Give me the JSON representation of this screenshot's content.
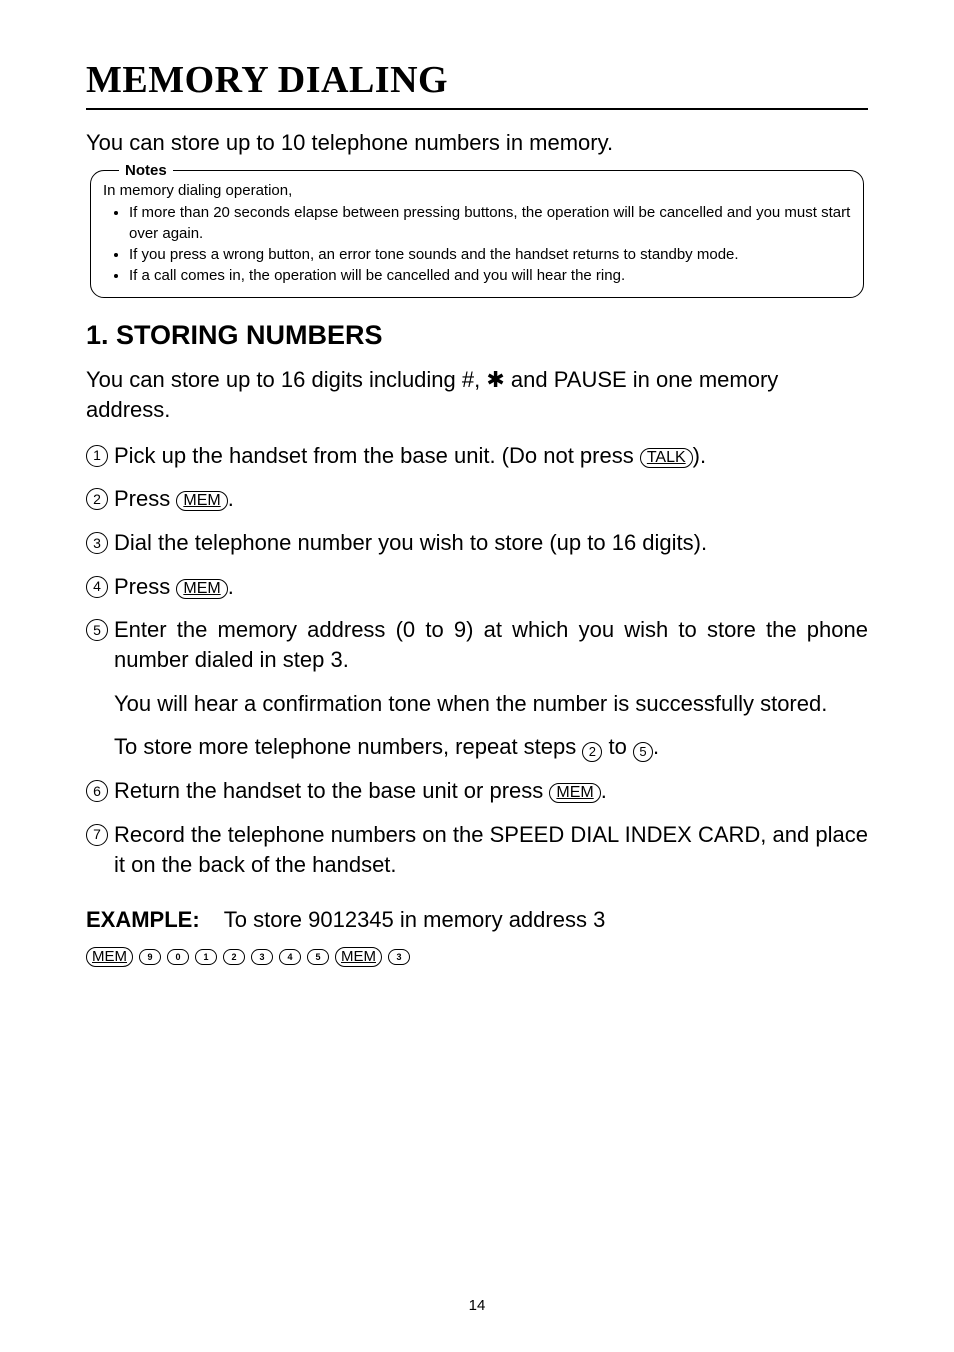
{
  "title": "MEMORY DIALING",
  "intro": "You can store up to 10 telephone numbers in memory.",
  "notes": {
    "label": "Notes",
    "lead": "In memory dialing operation,",
    "items": [
      "If more than 20 seconds elapse between pressing buttons, the operation will be cancelled and you must start over again.",
      "If you press a wrong button, an error tone sounds and the handset returns to standby mode.",
      "If a call comes in, the operation will be cancelled and you will hear the ring."
    ]
  },
  "section1": {
    "heading": "1. STORING NUMBERS",
    "intro_pre": "You can store up to 16 digits including #, ",
    "intro_star": "✱",
    "intro_post": " and PAUSE in one memory address.",
    "steps": {
      "s1_pre": "Pick up the handset from the base unit.  (Do not press ",
      "s1_key": "TALK",
      "s1_post": ").",
      "s2_pre": "Press ",
      "s2_key": "MEM",
      "s2_post": ".",
      "s3": "Dial the telephone number you wish to store (up to 16 digits).",
      "s4_pre": "Press ",
      "s4_key": "MEM",
      "s4_post": ".",
      "s5_a": "Enter the memory address (0 to 9) at which you wish to store the phone number dialed in step 3.",
      "s5_b": "You will hear a confirmation tone when the number is successfully stored.",
      "s5_c_pre": "To store more telephone numbers, repeat steps ",
      "s5_c_mid": " to ",
      "s5_c_post": ".",
      "s5_c_n1": "2",
      "s5_c_n2": "5",
      "s6_pre": "Return the handset to the base unit or press ",
      "s6_key": "MEM",
      "s6_post": ".",
      "s7": "Record the telephone numbers on the SPEED DIAL INDEX CARD, and place it on the back of the handset."
    },
    "example": {
      "label": "EXAMPLE:",
      "text": "To store 9012345 in memory address 3",
      "seq_mem": "MEM",
      "seq_keys": [
        "9",
        "0",
        "1",
        "2",
        "3",
        "4",
        "5"
      ],
      "seq_last": "3"
    }
  },
  "page_number": "14",
  "nums": {
    "n1": "1",
    "n2": "2",
    "n3": "3",
    "n4": "4",
    "n5": "5",
    "n6": "6",
    "n7": "7"
  }
}
